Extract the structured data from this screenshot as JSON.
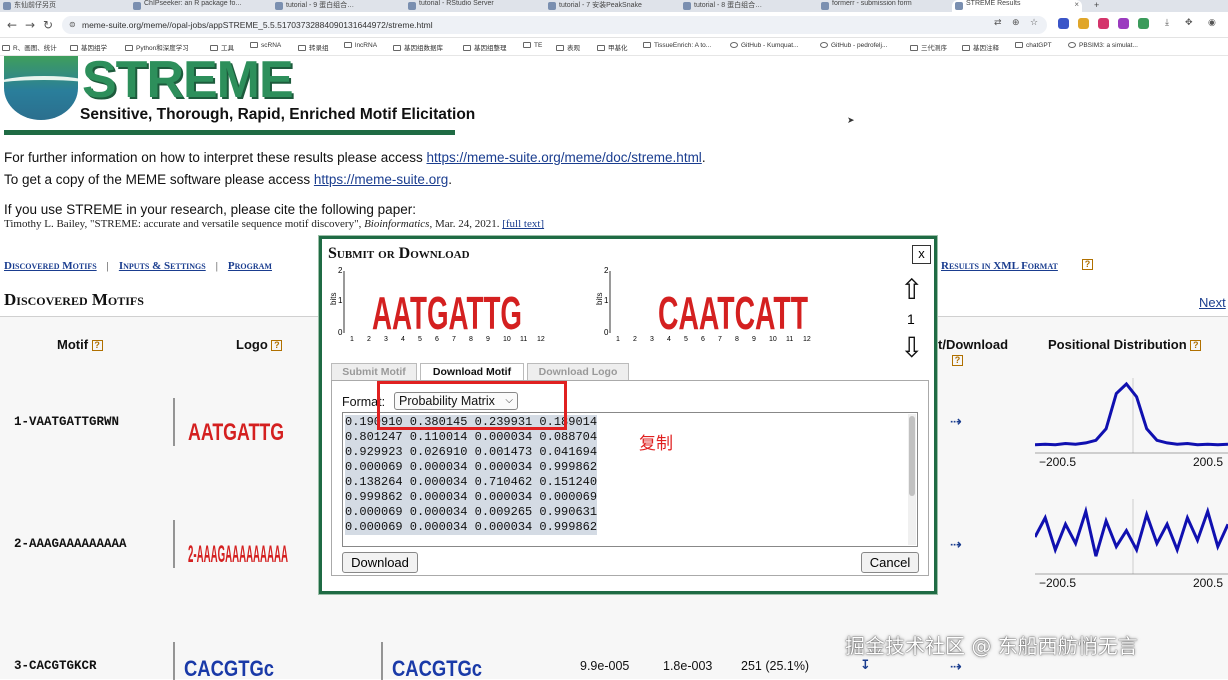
{
  "browser": {
    "tabs": [
      "东仙前仔另页",
      "ChIPseeker: an R package fo...",
      "tutorial - 9 蛋白组合…",
      "tutorial - RStudio Server",
      "tutorial - 7 安装PeakSnake",
      "tutorial - 8 蛋白组合…",
      "formerr - submission form",
      "STREME Results"
    ],
    "url": "meme-suite.org/meme//opal-jobs/appSTREME_5.5.51703732884090131644972/streme.html",
    "bookmarks": [
      "R、画图、统计",
      "基因组学",
      "Python和深度学习",
      "工具",
      "scRNA",
      "转录组",
      "lncRNA",
      "基因组数据库",
      "基因组整理",
      "TE",
      "表观",
      "甲基化",
      "TissueEnrich: A to...",
      "GitHub - Kumquat...",
      "GitHub - pedrofelj...",
      "三代测序",
      "基因注释",
      "chatGPT",
      "PBSIM3: a simulat..."
    ]
  },
  "page": {
    "logo_title": "STREME",
    "logo_subtitle": "Sensitive, Thorough, Rapid, Enriched Motif Elicitation",
    "info1_text": "For further information on how to interpret these results please access ",
    "info1_link": "https://meme-suite.org/meme/doc/streme.html",
    "info1_end": ".",
    "info2_text": "To get a copy of the MEME software please access ",
    "info2_link": "https://meme-suite.org",
    "info2_end": ".",
    "cite_intro": "If you use STREME in your research, please cite the following paper:",
    "cite_text": "Timothy L. Bailey, \"STREME: accurate and versatile sequence motif discovery\", ",
    "cite_journal": "Bioinformatics",
    "cite_date": ", Mar. 24, 2021. ",
    "cite_fulltext": "[full text]",
    "nav": {
      "discovered": "Discovered Motifs",
      "inputs": "Inputs & Settings",
      "program": "Program",
      "xml": "Results in XML Format",
      "sep": "|"
    },
    "section_title": "Discovered Motifs",
    "next": "Next",
    "table": {
      "headers": {
        "motif": "Motif",
        "logo": "Logo",
        "submit": "t/Download",
        "positional": "Positional Distribution"
      },
      "rows": [
        {
          "id": "1-VAATGATTGRWN",
          "axis_left": "−200.5",
          "axis_right": "200.5",
          "profile": [
            0.05,
            0.06,
            0.05,
            0.07,
            0.06,
            0.08,
            0.12,
            0.3,
            0.85,
            1.0,
            0.8,
            0.3,
            0.12,
            0.08,
            0.06,
            0.07,
            0.05,
            0.06,
            0.05,
            0.06
          ]
        },
        {
          "id": "2-AAAGAAAAAAAAA",
          "axis_left": "−200.5",
          "axis_right": "200.5",
          "profile": [
            0.5,
            0.8,
            0.3,
            0.7,
            0.4,
            0.9,
            0.2,
            0.75,
            0.35,
            0.6,
            0.3,
            0.85,
            0.4,
            0.7,
            0.3,
            0.8,
            0.45,
            0.9,
            0.35,
            0.7
          ]
        },
        {
          "id": "3-CACGTGKCR",
          "evalue": "9.9e-005",
          "pvalue": "1.8e-003",
          "sites": "251 (25.1%)"
        }
      ],
      "arrow_glyph": "⇢"
    }
  },
  "dialog": {
    "title": "Submit or Download",
    "close": "x",
    "motif_number": "1",
    "logo_axis_label": "bits",
    "logo1_text": "AATGATTG",
    "logo2_text": "CAATCATT",
    "logo1_ticks": [
      "1",
      "2",
      "3",
      "4",
      "5",
      "6",
      "7",
      "8",
      "9",
      "10",
      "11",
      "12"
    ],
    "logo2_ticks": [
      "1",
      "2",
      "3",
      "4",
      "5",
      "6",
      "7",
      "8",
      "9",
      "10",
      "11",
      "12"
    ],
    "tabs": [
      "Submit Motif",
      "Download Motif",
      "Download Logo"
    ],
    "active_tab": 1,
    "format_label": "Format:",
    "format_value": "Probability Matrix",
    "matrix_lines": [
      "0.190910 0.380145 0.239931 0.189014",
      "0.801247 0.110014 0.000034 0.088704",
      "0.929923 0.026910 0.001473 0.041694",
      "0.000069 0.000034 0.000034 0.999862",
      "0.138264 0.000034 0.710462 0.151240",
      "0.999862 0.000034 0.000034 0.000069",
      "0.000069 0.000034 0.009265 0.990631",
      "0.000069 0.000034 0.000034 0.999862"
    ],
    "download_btn": "Download",
    "cancel_btn": "Cancel"
  },
  "annotation": {
    "note": "复制",
    "color": "#e02020"
  },
  "watermark": "掘金技术社区 @ 东船西舫悄无言"
}
